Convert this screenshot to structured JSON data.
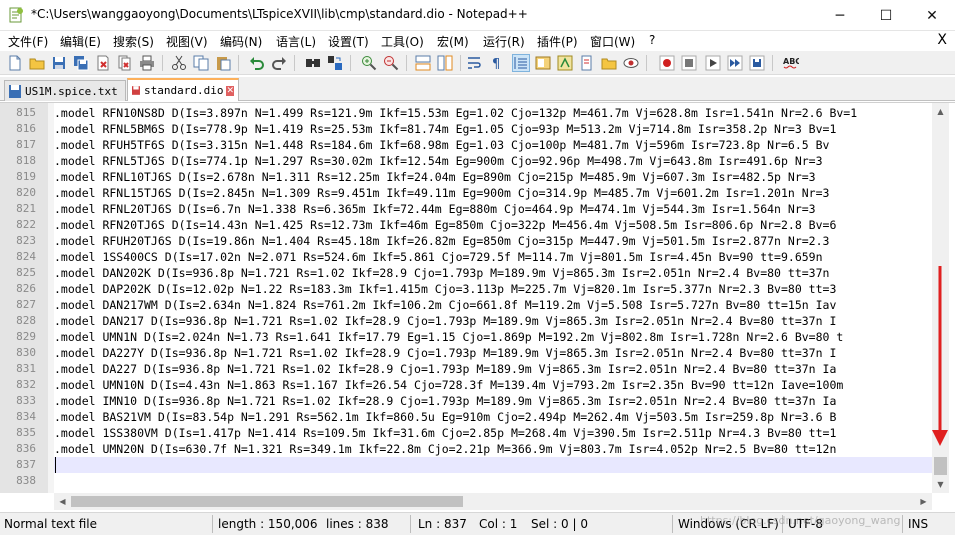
{
  "window": {
    "title": "*C:\\Users\\wanggaoyong\\Documents\\LTspiceXVII\\lib\\cmp\\standard.dio - Notepad++",
    "minimize_glyph": "─",
    "maximize_glyph": "☐",
    "close_glyph": "✕"
  },
  "menu": {
    "items": [
      "文件(F)",
      "编辑(E)",
      "搜索(S)",
      "视图(V)",
      "编码(N)",
      "语言(L)",
      "设置(T)",
      "工具(O)",
      "宏(M)",
      "运行(R)",
      "插件(P)",
      "窗口(W)",
      "?"
    ],
    "close_glyph": "X"
  },
  "tabs": [
    {
      "label": "US1M.spice.txt",
      "active": false
    },
    {
      "label": "standard.dio",
      "active": true
    }
  ],
  "editor": {
    "lines": [
      {
        "num": "815",
        "text": ".model RFN10NS8D D(Is=3.897n N=1.499 Rs=121.9m Ikf=15.53m Eg=1.02 Cjo=132p M=461.7m Vj=628.8m Isr=1.541n Nr=2.6 Bv=1"
      },
      {
        "num": "816",
        "text": ".model RFNL5BM6S D(Is=778.9p N=1.419 Rs=25.53m Ikf=81.74m Eg=1.05 Cjo=93p M=513.2m Vj=714.8m Isr=358.2p Nr=3 Bv=1"
      },
      {
        "num": "817",
        "text": ".model RFUH5TF6S D(Is=3.315n N=1.448 Rs=184.6m Ikf=68.98m Eg=1.03 Cjo=100p M=481.7m Vj=596m Isr=723.8p Nr=6.5 Bv"
      },
      {
        "num": "818",
        "text": ".model RFNL5TJ6S D(Is=774.1p N=1.297 Rs=30.02m Ikf=12.54m Eg=900m Cjo=92.96p M=498.7m Vj=643.8m Isr=491.6p Nr=3 "
      },
      {
        "num": "819",
        "text": ".model RFNL10TJ6S D(Is=2.678n N=1.311 Rs=12.25m Ikf=24.04m Eg=890m Cjo=215p M=485.9m Vj=607.3m Isr=482.5p Nr=3 "
      },
      {
        "num": "820",
        "text": ".model RFNL15TJ6S D(Is=2.845n N=1.309 Rs=9.451m Ikf=49.11m Eg=900m Cjo=314.9p M=485.7m Vj=601.2m Isr=1.201n Nr=3 "
      },
      {
        "num": "821",
        "text": ".model RFNL20TJ6S D(Is=6.7n N=1.338 Rs=6.365m Ikf=72.44m Eg=880m Cjo=464.9p M=474.1m Vj=544.3m Isr=1.564n Nr=3 "
      },
      {
        "num": "822",
        "text": ".model RFN20TJ6S D(Is=14.43n N=1.425 Rs=12.73m Ikf=46m Eg=850m Cjo=322p M=456.4m Vj=508.5m Isr=806.6p Nr=2.8 Bv=6"
      },
      {
        "num": "823",
        "text": ".model RFUH20TJ6S D(Is=19.86n N=1.404 Rs=45.18m Ikf=26.82m Eg=850m Cjo=315p M=447.9m Vj=501.5m Isr=2.877n Nr=2.3 "
      },
      {
        "num": "824",
        "text": ".model 1SS400CS D(Is=17.02n N=2.071 Rs=524.6m Ikf=5.861 Cjo=729.5f M=114.7m Vj=801.5m Isr=4.45n Bv=90 tt=9.659n"
      },
      {
        "num": "825",
        "text": ".model DAN202K D(Is=936.8p N=1.721 Rs=1.02 Ikf=28.9 Cjo=1.793p M=189.9m Vj=865.3m Isr=2.051n Nr=2.4 Bv=80 tt=37n"
      },
      {
        "num": "826",
        "text": ".model DAP202K D(Is=12.02p N=1.22 Rs=183.3m Ikf=1.415m Cjo=3.113p M=225.7m Vj=820.1m Isr=5.377n Nr=2.3 Bv=80 tt=3"
      },
      {
        "num": "827",
        "text": ".model DAN217WM D(Is=2.634n N=1.824 Rs=761.2m Ikf=106.2m Cjo=661.8f M=119.2m Vj=5.508 Isr=5.727n Bv=80 tt=15n Iav"
      },
      {
        "num": "828",
        "text": ".model DAN217 D(Is=936.8p N=1.721 Rs=1.02 Ikf=28.9 Cjo=1.793p M=189.9m Vj=865.3m Isr=2.051n Nr=2.4 Bv=80 tt=37n I"
      },
      {
        "num": "829",
        "text": ".model UMN1N D(Is=2.024n N=1.73 Rs=1.641 Ikf=17.79 Eg=1.15 Cjo=1.869p M=192.2m Vj=802.8m Isr=1.728n Nr=2.6 Bv=80 t"
      },
      {
        "num": "830",
        "text": ".model DA227Y D(Is=936.8p N=1.721 Rs=1.02 Ikf=28.9 Cjo=1.793p M=189.9m Vj=865.3m Isr=2.051n Nr=2.4 Bv=80 tt=37n I"
      },
      {
        "num": "831",
        "text": ".model DA227 D(Is=936.8p N=1.721 Rs=1.02 Ikf=28.9 Cjo=1.793p M=189.9m Vj=865.3m Isr=2.051n Nr=2.4 Bv=80 tt=37n Ia"
      },
      {
        "num": "832",
        "text": ".model UMN10N D(Is=4.43n N=1.863 Rs=1.167 Ikf=26.54 Cjo=728.3f M=139.4m Vj=793.2m Isr=2.35n Bv=90 tt=12n Iave=100m"
      },
      {
        "num": "833",
        "text": ".model IMN10 D(Is=936.8p N=1.721 Rs=1.02 Ikf=28.9 Cjo=1.793p M=189.9m Vj=865.3m Isr=2.051n Nr=2.4 Bv=80 tt=37n Ia"
      },
      {
        "num": "834",
        "text": ".model BAS21VM D(Is=83.54p N=1.291 Rs=562.1m Ikf=860.5u Eg=910m Cjo=2.494p M=262.4m Vj=503.5m Isr=259.8p Nr=3.6 B"
      },
      {
        "num": "835",
        "text": ".model 1SS380VM D(Is=1.417p N=1.414 Rs=109.5m Ikf=31.6m Cjo=2.85p M=268.4m Vj=390.5m Isr=2.511p Nr=4.3 Bv=80 tt=1"
      },
      {
        "num": "836",
        "text": ".model UMN20N D(Is=630.7f N=1.321 Rs=349.1m Ikf=22.8m Cjo=2.21p M=366.9m Vj=803.7m Isr=4.052p Nr=2.5 Bv=80 tt=12n"
      },
      {
        "num": "837",
        "text": ""
      },
      {
        "num": "838",
        "text": ""
      }
    ],
    "current_line_index": 22
  },
  "status": {
    "filetype": "Normal text file",
    "length": "length : 150,006",
    "lines": "lines : 838",
    "ln": "Ln : 837",
    "col": "Col : 1",
    "sel": "Sel : 0 | 0",
    "eol": "Windows (CR LF)",
    "encoding": "UTF-8",
    "mode": "INS"
  },
  "watermark": "https://blog.csdn.net/gaoyong_wang",
  "colors": {
    "annotation_arrow": "#e02020",
    "current_line": "#e8e8ff",
    "active_tab_accent": "#fdb05a"
  },
  "icons": [
    "new-file-icon",
    "open-file-icon",
    "save-icon",
    "save-all-icon",
    "close-icon",
    "close-all-icon",
    "print-icon",
    "cut-icon",
    "copy-icon",
    "paste-icon",
    "undo-icon",
    "redo-icon",
    "find-icon",
    "replace-icon",
    "zoom-in-icon",
    "zoom-out-icon",
    "sync-v-icon",
    "sync-h-icon",
    "word-wrap-icon",
    "show-all-chars-icon",
    "indent-guide-icon",
    "doc-map-icon",
    "function-list-icon",
    "folder-workspace-icon",
    "monitoring-icon",
    "record-macro-icon",
    "stop-record-icon",
    "play-macro-icon",
    "run-macro-multiple-icon",
    "save-macro-icon",
    "spell-check-icon"
  ]
}
